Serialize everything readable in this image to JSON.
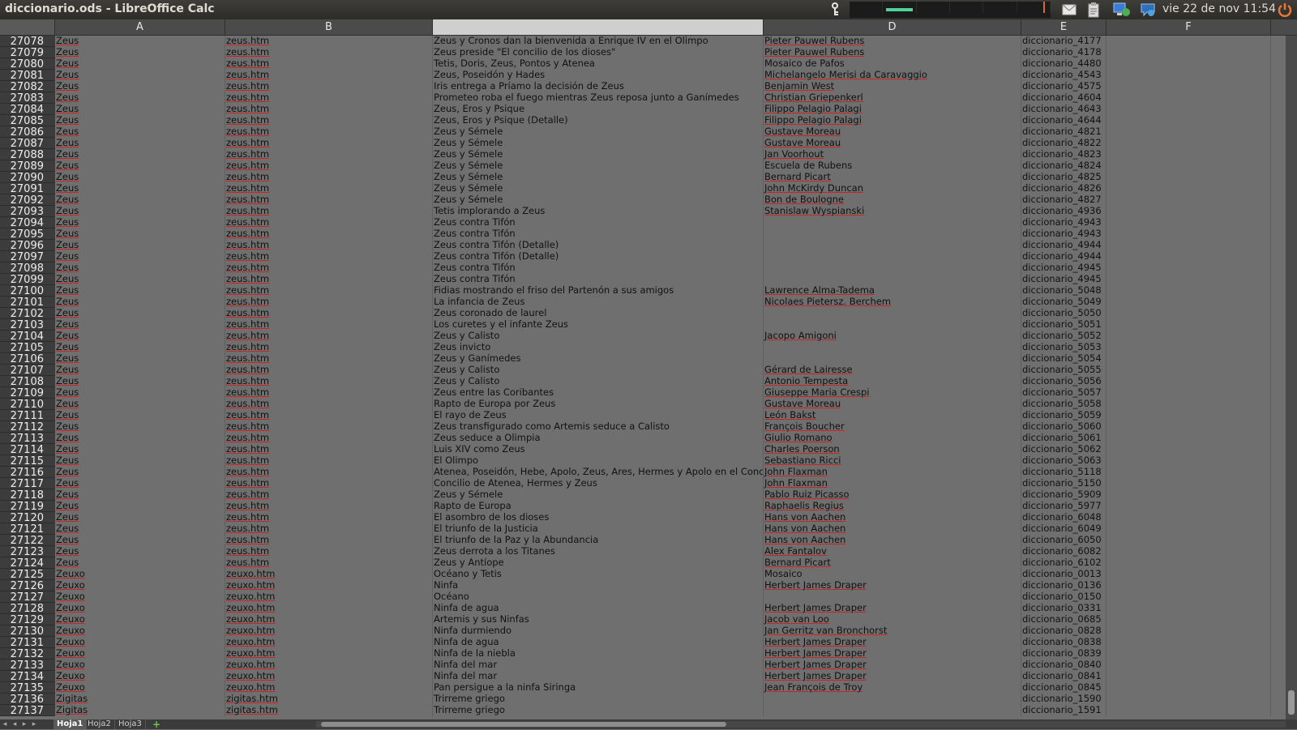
{
  "window": {
    "title": "diccionario.ods - LibreOffice Calc"
  },
  "topbar": {
    "clock": "vie 22 de nov  11:54",
    "tray_icons": [
      "key-icon",
      "system-monitor-icon",
      "mail-icon",
      "clipboard-icon",
      "network-icon",
      "chat-icon",
      "power-icon"
    ]
  },
  "columns": [
    {
      "id": "A",
      "label": "A"
    },
    {
      "id": "B",
      "label": "B"
    },
    {
      "id": "C",
      "label": ""
    },
    {
      "id": "D",
      "label": "D"
    },
    {
      "id": "E",
      "label": "E"
    },
    {
      "id": "F",
      "label": "F"
    }
  ],
  "rows": [
    {
      "n": "27078",
      "a": "Zeus",
      "b": "zeus.htm",
      "c": "Zeus y Cronos dan la bienvenida a Enrique IV en el Olimpo",
      "d": "Pieter Pauwel Rubens",
      "e": "diccionario_4177"
    },
    {
      "n": "27079",
      "a": "Zeus",
      "b": "zeus.htm",
      "c": "Zeus preside \"El concilio de los dioses\"",
      "d": "Pieter Pauwel Rubens",
      "e": "diccionario_4178"
    },
    {
      "n": "27080",
      "a": "Zeus",
      "b": "zeus.htm",
      "c": "Tetis, Doris, Zeus, Pontos y Atenea",
      "d": "Mosaico de Pafos",
      "e": "diccionario_4480"
    },
    {
      "n": "27081",
      "a": "Zeus",
      "b": "zeus.htm",
      "c": "Zeus, Poseidón y Hades",
      "d": "Michelangelo Merisi da Caravaggio",
      "e": "diccionario_4543"
    },
    {
      "n": "27082",
      "a": "Zeus",
      "b": "zeus.htm",
      "c": "Iris entrega a Príamo la decisión de Zeus",
      "d": "Benjamin West",
      "e": "diccionario_4575"
    },
    {
      "n": "27083",
      "a": "Zeus",
      "b": "zeus.htm",
      "c": "Prometeo roba el fuego mientras Zeus reposa junto a Ganímedes",
      "d": "Christian Griepenkerl",
      "e": "diccionario_4604"
    },
    {
      "n": "27084",
      "a": "Zeus",
      "b": "zeus.htm",
      "c": "Zeus, Eros y Psique",
      "d": "Filippo Pelagio Palagi",
      "e": "diccionario_4643"
    },
    {
      "n": "27085",
      "a": "Zeus",
      "b": "zeus.htm",
      "c": "Zeus, Eros y Psique (Detalle)",
      "d": "Filippo Pelagio Palagi",
      "e": "diccionario_4644"
    },
    {
      "n": "27086",
      "a": "Zeus",
      "b": "zeus.htm",
      "c": "Zeus y Sémele",
      "d": "Gustave Moreau",
      "e": "diccionario_4821"
    },
    {
      "n": "27087",
      "a": "Zeus",
      "b": "zeus.htm",
      "c": "Zeus y Sémele",
      "d": "Gustave Moreau",
      "e": "diccionario_4822"
    },
    {
      "n": "27088",
      "a": "Zeus",
      "b": "zeus.htm",
      "c": "Zeus y Sémele",
      "d": "Jan Voorhout",
      "e": "diccionario_4823"
    },
    {
      "n": "27089",
      "a": "Zeus",
      "b": "zeus.htm",
      "c": "Zeus y Sémele",
      "d": "Escuela de Rubens",
      "e": "diccionario_4824"
    },
    {
      "n": "27090",
      "a": "Zeus",
      "b": "zeus.htm",
      "c": "Zeus y Sémele",
      "d": "Bernard Picart",
      "e": "diccionario_4825"
    },
    {
      "n": "27091",
      "a": "Zeus",
      "b": "zeus.htm",
      "c": "Zeus y Sémele",
      "d": "John McKirdy Duncan",
      "e": "diccionario_4826"
    },
    {
      "n": "27092",
      "a": "Zeus",
      "b": "zeus.htm",
      "c": "Zeus y Sémele",
      "d": "Bon de Boulogne",
      "e": "diccionario_4827"
    },
    {
      "n": "27093",
      "a": "Zeus",
      "b": "zeus.htm",
      "c": "Tetis implorando a Zeus",
      "d": "Stanislaw Wyspianski",
      "e": "diccionario_4936"
    },
    {
      "n": "27094",
      "a": "Zeus",
      "b": "zeus.htm",
      "c": "Zeus contra Tifón",
      "d": "",
      "e": "diccionario_4943"
    },
    {
      "n": "27095",
      "a": "Zeus",
      "b": "zeus.htm",
      "c": "Zeus contra Tifón",
      "d": "",
      "e": "diccionario_4943"
    },
    {
      "n": "27096",
      "a": "Zeus",
      "b": "zeus.htm",
      "c": "Zeus contra Tifón (Detalle)",
      "d": "",
      "e": "diccionario_4944"
    },
    {
      "n": "27097",
      "a": "Zeus",
      "b": "zeus.htm",
      "c": "Zeus contra Tifón (Detalle)",
      "d": "",
      "e": "diccionario_4944"
    },
    {
      "n": "27098",
      "a": "Zeus",
      "b": "zeus.htm",
      "c": "Zeus contra Tifón",
      "d": "",
      "e": "diccionario_4945"
    },
    {
      "n": "27099",
      "a": "Zeus",
      "b": "zeus.htm",
      "c": "Zeus contra Tifón",
      "d": "",
      "e": "diccionario_4945"
    },
    {
      "n": "27100",
      "a": "Zeus",
      "b": "zeus.htm",
      "c": "Fidias mostrando el friso del Partenón a sus amigos",
      "d": "Lawrence Alma-Tadema",
      "e": "diccionario_5048"
    },
    {
      "n": "27101",
      "a": "Zeus",
      "b": "zeus.htm",
      "c": "La infancia de Zeus",
      "d": "Nicolaes Pietersz. Berchem",
      "e": "diccionario_5049"
    },
    {
      "n": "27102",
      "a": "Zeus",
      "b": "zeus.htm",
      "c": "Zeus coronado de laurel",
      "d": "",
      "e": "diccionario_5050"
    },
    {
      "n": "27103",
      "a": "Zeus",
      "b": "zeus.htm",
      "c": "Los curetes y el infante Zeus",
      "d": "",
      "e": "diccionario_5051"
    },
    {
      "n": "27104",
      "a": "Zeus",
      "b": "zeus.htm",
      "c": "Zeus y Calisto",
      "d": "Jacopo Amigoni",
      "e": "diccionario_5052"
    },
    {
      "n": "27105",
      "a": "Zeus",
      "b": "zeus.htm",
      "c": "Zeus invicto",
      "d": "",
      "e": "diccionario_5053"
    },
    {
      "n": "27106",
      "a": "Zeus",
      "b": "zeus.htm",
      "c": "Zeus y Ganímedes",
      "d": "",
      "e": "diccionario_5054"
    },
    {
      "n": "27107",
      "a": "Zeus",
      "b": "zeus.htm",
      "c": "Zeus y Calisto",
      "d": "Gérard de Lairesse",
      "e": "diccionario_5055"
    },
    {
      "n": "27108",
      "a": "Zeus",
      "b": "zeus.htm",
      "c": "Zeus y Calisto",
      "d": "Antonio Tempesta",
      "e": "diccionario_5056"
    },
    {
      "n": "27109",
      "a": "Zeus",
      "b": "zeus.htm",
      "c": "Zeus entre las Coribantes",
      "d": "Giuseppe Maria Crespi",
      "e": "diccionario_5057"
    },
    {
      "n": "27110",
      "a": "Zeus",
      "b": "zeus.htm",
      "c": "Rapto de Europa por Zeus",
      "d": "Gustave Moreau",
      "e": "diccionario_5058"
    },
    {
      "n": "27111",
      "a": "Zeus",
      "b": "zeus.htm",
      "c": "El rayo de Zeus",
      "d": "León Bakst",
      "e": "diccionario_5059"
    },
    {
      "n": "27112",
      "a": "Zeus",
      "b": "zeus.htm",
      "c": "Zeus transfigurado como Artemis seduce a Calisto",
      "d": "François Boucher",
      "e": "diccionario_5060"
    },
    {
      "n": "27113",
      "a": "Zeus",
      "b": "zeus.htm",
      "c": "Zeus seduce a Olimpia",
      "d": "Giulio Romano",
      "e": "diccionario_5061"
    },
    {
      "n": "27114",
      "a": "Zeus",
      "b": "zeus.htm",
      "c": "Luis XIV como Zeus",
      "d": "Charles Poerson",
      "e": "diccionario_5062"
    },
    {
      "n": "27115",
      "a": "Zeus",
      "b": "zeus.htm",
      "c": "El Olimpo",
      "d": "Sebastiano Ricci",
      "e": "diccionario_5063"
    },
    {
      "n": "27116",
      "a": "Zeus",
      "b": "zeus.htm",
      "c": "Atenea, Poseidón, Hebe, Apolo, Zeus, Ares, Hermes y Apolo en el Concilio",
      "d": "John Flaxman",
      "e": "diccionario_5118"
    },
    {
      "n": "27117",
      "a": "Zeus",
      "b": "zeus.htm",
      "c": "Concilio de Atenea, Hermes y Zeus",
      "d": "John Flaxman",
      "e": "diccionario_5150"
    },
    {
      "n": "27118",
      "a": "Zeus",
      "b": "zeus.htm",
      "c": "Zeus y Sémele",
      "d": "Pablo Ruiz Picasso",
      "e": "diccionario_5909"
    },
    {
      "n": "27119",
      "a": "Zeus",
      "b": "zeus.htm",
      "c": "Rapto de Europa",
      "d": "Raphaelis Regius",
      "e": "diccionario_5977"
    },
    {
      "n": "27120",
      "a": "Zeus",
      "b": "zeus.htm",
      "c": "El asombro de los dioses",
      "d": "Hans von Aachen",
      "e": "diccionario_6048"
    },
    {
      "n": "27121",
      "a": "Zeus",
      "b": "zeus.htm",
      "c": "El triunfo de la Justicia",
      "d": "Hans von Aachen",
      "e": "diccionario_6049"
    },
    {
      "n": "27122",
      "a": "Zeus",
      "b": "zeus.htm",
      "c": "El triunfo de la Paz y la Abundancia",
      "d": "Hans von Aachen",
      "e": "diccionario_6050"
    },
    {
      "n": "27123",
      "a": "Zeus",
      "b": "zeus.htm",
      "c": "Zeus derrota a los Titanes",
      "d": "Alex Fantalov",
      "e": "diccionario_6082"
    },
    {
      "n": "27124",
      "a": "Zeus",
      "b": "zeus.htm",
      "c": "Zeus y Antíope",
      "d": "Bernard Picart",
      "e": "diccionario_6102"
    },
    {
      "n": "27125",
      "a": "Zeuxo",
      "b": "zeuxo.htm",
      "c": "Océano y Tetis",
      "d": "Mosaico",
      "e": "diccionario_0013"
    },
    {
      "n": "27126",
      "a": "Zeuxo",
      "b": "zeuxo.htm",
      "c": "Ninfa",
      "d": "Herbert James Draper",
      "e": "diccionario_0136"
    },
    {
      "n": "27127",
      "a": "Zeuxo",
      "b": "zeuxo.htm",
      "c": "Océano",
      "d": "",
      "e": "diccionario_0150"
    },
    {
      "n": "27128",
      "a": "Zeuxo",
      "b": "zeuxo.htm",
      "c": "Ninfa de agua",
      "d": "Herbert James Draper",
      "e": "diccionario_0331"
    },
    {
      "n": "27129",
      "a": "Zeuxo",
      "b": "zeuxo.htm",
      "c": "Artemis y sus Ninfas",
      "d": "Jacob van Loo",
      "e": "diccionario_0685"
    },
    {
      "n": "27130",
      "a": "Zeuxo",
      "b": "zeuxo.htm",
      "c": "Ninfa durmiendo",
      "d": "Jan Gerritz van Bronchorst",
      "e": "diccionario_0828"
    },
    {
      "n": "27131",
      "a": "Zeuxo",
      "b": "zeuxo.htm",
      "c": "Ninfa de agua",
      "d": "Herbert James Draper",
      "e": "diccionario_0838"
    },
    {
      "n": "27132",
      "a": "Zeuxo",
      "b": "zeuxo.htm",
      "c": "Ninfa de la niebla",
      "d": "Herbert James Draper",
      "e": "diccionario_0839"
    },
    {
      "n": "27133",
      "a": "Zeuxo",
      "b": "zeuxo.htm",
      "c": "Ninfa del mar",
      "d": "Herbert James Draper",
      "e": "diccionario_0840"
    },
    {
      "n": "27134",
      "a": "Zeuxo",
      "b": "zeuxo.htm",
      "c": "Ninfa del mar",
      "d": "Herbert James Draper",
      "e": "diccionario_0841"
    },
    {
      "n": "27135",
      "a": "Zeuxo",
      "b": "zeuxo.htm",
      "c": "Pan persigue a la ninfa Siringa",
      "d": "Jean François de Troy",
      "e": "diccionario_0845"
    },
    {
      "n": "27136",
      "a": "Zigitas",
      "b": "zigitas.htm",
      "c": "Trirreme griego",
      "d": "",
      "e": "diccionario_1590"
    },
    {
      "n": "27137",
      "a": "Zigitas",
      "b": "zigitas.htm",
      "c": "Trirreme griego",
      "d": "",
      "e": "diccionario_1591"
    }
  ],
  "sheets": [
    {
      "label": "Hoja1",
      "active": true
    },
    {
      "label": "Hoja2",
      "active": false
    },
    {
      "label": "Hoja3",
      "active": false
    }
  ],
  "add_sheet_label": "+"
}
